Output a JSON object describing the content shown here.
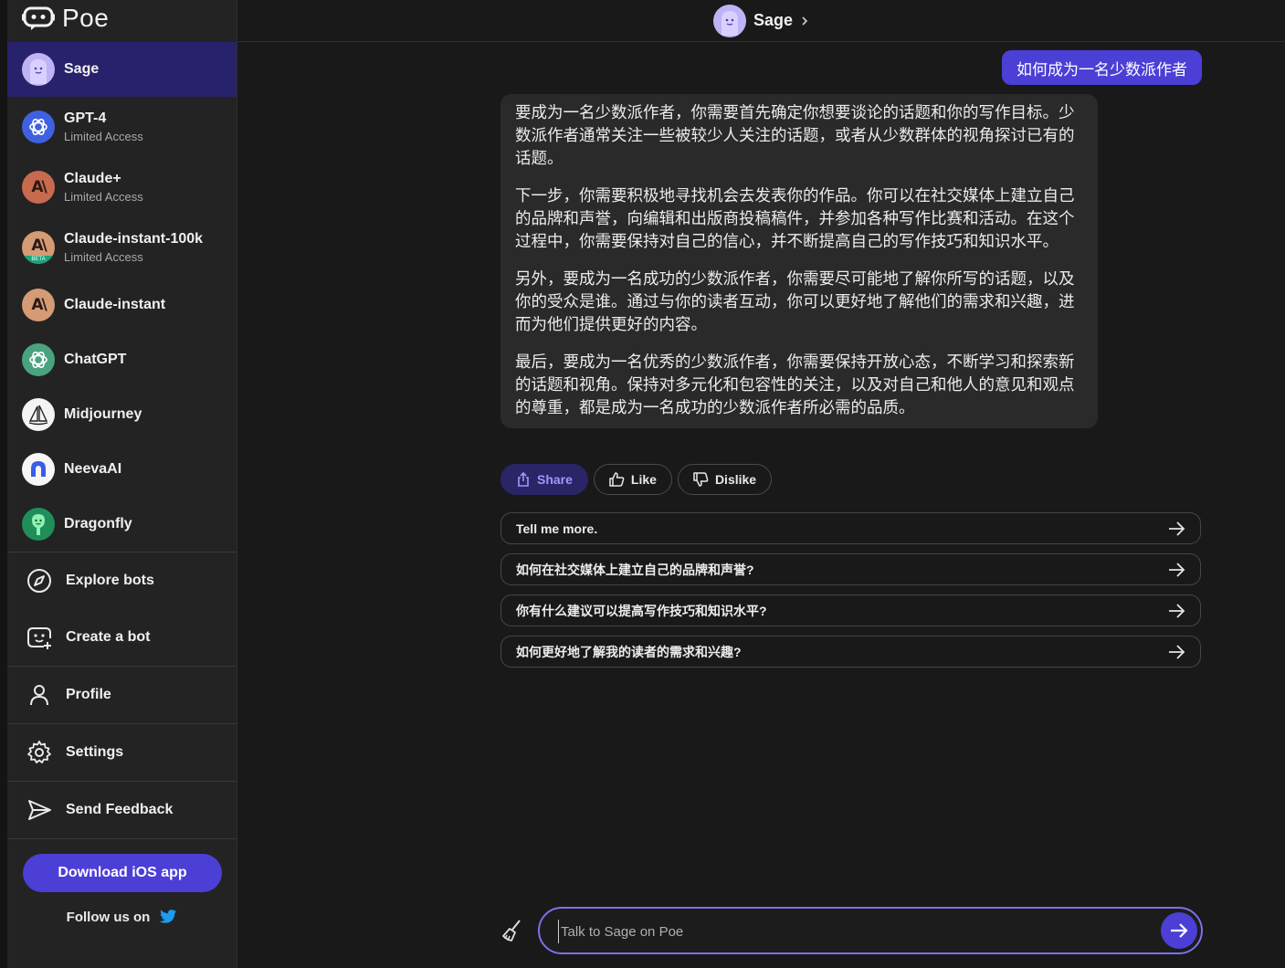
{
  "app": {
    "name": "Poe"
  },
  "header": {
    "bot_name": "Sage"
  },
  "sidebar": {
    "bots": [
      {
        "name": "Sage",
        "subtitle": "",
        "icon": "sage-avatar-icon",
        "active": true
      },
      {
        "name": "GPT-4",
        "subtitle": "Limited Access",
        "icon": "gpt4-avatar-icon"
      },
      {
        "name": "Claude+",
        "subtitle": "Limited Access",
        "icon": "claude-plus-avatar-icon"
      },
      {
        "name": "Claude-instant-100k",
        "subtitle": "Limited Access",
        "icon": "claude-instant-100k-avatar-icon",
        "badge": "BETA"
      },
      {
        "name": "Claude-instant",
        "subtitle": "",
        "icon": "claude-instant-avatar-icon"
      },
      {
        "name": "ChatGPT",
        "subtitle": "",
        "icon": "chatgpt-avatar-icon"
      },
      {
        "name": "Midjourney",
        "subtitle": "",
        "icon": "midjourney-avatar-icon"
      },
      {
        "name": "NeevaAI",
        "subtitle": "",
        "icon": "neevaai-avatar-icon"
      },
      {
        "name": "Dragonfly",
        "subtitle": "",
        "icon": "dragonfly-avatar-icon"
      }
    ],
    "nav": {
      "explore": "Explore bots",
      "create": "Create a bot",
      "profile": "Profile",
      "settings": "Settings",
      "feedback": "Send Feedback"
    },
    "download_label": "Download iOS app",
    "follow_label": "Follow us on"
  },
  "chat": {
    "user_message": "如何成为一名少数派作者",
    "bot_paragraphs": [
      "要成为一名少数派作者，你需要首先确定你想要谈论的话题和你的写作目标。少数派作者通常关注一些被较少人关注的话题，或者从少数群体的视角探讨已有的话题。",
      "下一步，你需要积极地寻找机会去发表你的作品。你可以在社交媒体上建立自己的品牌和声誉，向编辑和出版商投稿稿件，并参加各种写作比赛和活动。在这个过程中，你需要保持对自己的信心，并不断提高自己的写作技巧和知识水平。",
      "另外，要成为一名成功的少数派作者，你需要尽可能地了解你所写的话题，以及你的受众是谁。通过与你的读者互动，你可以更好地了解他们的需求和兴趣，进而为他们提供更好的内容。",
      "最后，要成为一名优秀的少数派作者，你需要保持开放心态，不断学习和探索新的话题和视角。保持对多元化和包容性的关注，以及对自己和他人的意见和观点的尊重，都是成为一名成功的少数派作者所必需的品质。"
    ],
    "actions": {
      "share": "Share",
      "like": "Like",
      "dislike": "Dislike"
    },
    "suggestions": [
      "Tell me more.",
      "如何在社交媒体上建立自己的品牌和声誉?",
      "你有什么建议可以提高写作技巧和知识水平?",
      "如何更好地了解我的读者的需求和兴趣?"
    ]
  },
  "composer": {
    "placeholder": "Talk to Sage on Poe"
  },
  "colors": {
    "accent": "#4b3fd6",
    "active_bot_bg": "#28226c",
    "background": "#191919",
    "sidebar_bg": "#232323"
  }
}
